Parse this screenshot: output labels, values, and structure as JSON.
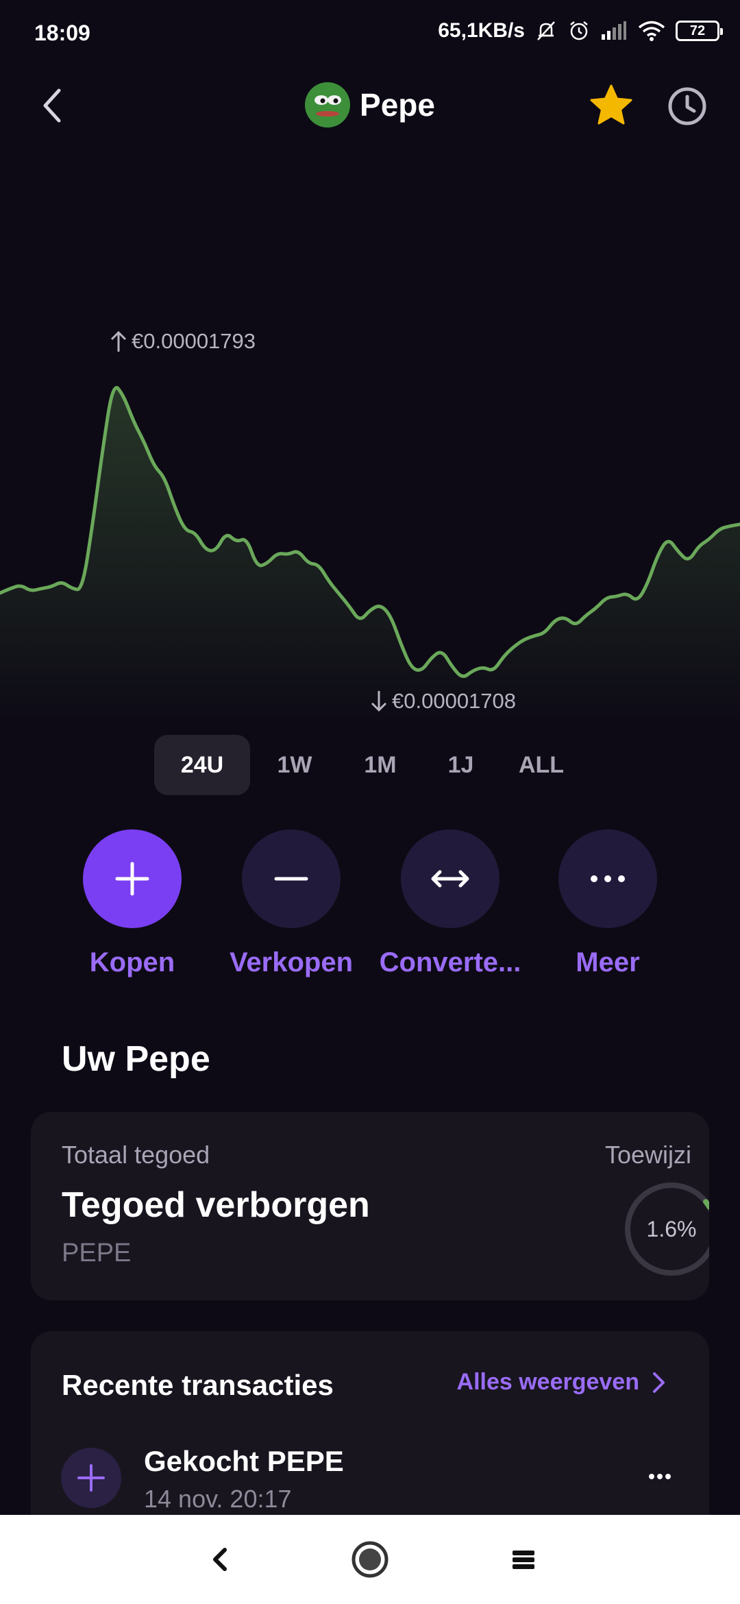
{
  "status_bar": {
    "time": "18:09",
    "network_speed": "65,1KB/s",
    "battery": "72",
    "icons": [
      "mute-bell-icon",
      "alarm-icon",
      "signal-icon",
      "wifi-icon",
      "battery-icon"
    ]
  },
  "header": {
    "title": "Pepe",
    "icons": [
      "back-arrow-icon",
      "pepe-logo",
      "star-icon",
      "history-clock-icon"
    ],
    "favorite_color": "#f5b800"
  },
  "chart": {
    "high_label": "€0.00001793",
    "low_label": "€0.00001708",
    "line_color": "#6aa85a"
  },
  "chart_data": {
    "type": "line",
    "title": "",
    "xlabel": "",
    "ylabel": "",
    "x": [
      0,
      1,
      2,
      3,
      4,
      5,
      6,
      7,
      8,
      9,
      10,
      11,
      12,
      13,
      14,
      15,
      16,
      17,
      18,
      19,
      20,
      21,
      22,
      23,
      24,
      25,
      26,
      27,
      28,
      29,
      30,
      31,
      32,
      33,
      34,
      35,
      36,
      37,
      38,
      39,
      40,
      41,
      42,
      43,
      44,
      45,
      46,
      47,
      48,
      49,
      50,
      51,
      52,
      53,
      54,
      55,
      56,
      57,
      58,
      59,
      60,
      61,
      62,
      63,
      64,
      65,
      66,
      67,
      68,
      69,
      70,
      71,
      72
    ],
    "values": [
      1.7557,
      1.7562,
      1.7566,
      1.7559,
      1.7562,
      1.7564,
      1.757,
      1.7562,
      1.756,
      1.7633,
      1.7719,
      1.7793,
      1.7779,
      1.7749,
      1.7727,
      1.7699,
      1.7687,
      1.7653,
      1.7627,
      1.7625,
      1.7605,
      1.7604,
      1.7625,
      1.7614,
      1.7619,
      1.7586,
      1.759,
      1.7602,
      1.76,
      1.7605,
      1.759,
      1.7589,
      1.757,
      1.7556,
      1.7542,
      1.7525,
      1.7538,
      1.7544,
      1.7532,
      1.75,
      1.7473,
      1.7469,
      1.7485,
      1.7493,
      1.7474,
      1.7461,
      1.747,
      1.7474,
      1.7469,
      1.7486,
      1.7497,
      1.7505,
      1.7509,
      1.7512,
      1.7527,
      1.753,
      1.752,
      1.7532,
      1.754,
      1.7552,
      1.7553,
      1.7557,
      1.7547,
      1.7567,
      1.76,
      1.7619,
      1.7603,
      1.7592,
      1.761,
      1.7617,
      1.7629,
      1.7632,
      1.7634
    ],
    "value_unit": "€ × 10^-5",
    "range": "24U",
    "grid": false,
    "legend": "none"
  },
  "range_tabs": [
    {
      "label": "24U",
      "active": true
    },
    {
      "label": "1W",
      "active": false
    },
    {
      "label": "1M",
      "active": false
    },
    {
      "label": "1J",
      "active": false
    },
    {
      "label": "ALL",
      "active": false
    }
  ],
  "actions": [
    {
      "label": "Kopen",
      "icon": "plus-icon",
      "primary": true
    },
    {
      "label": "Verkopen",
      "icon": "minus-icon",
      "primary": false
    },
    {
      "label": "Converte...",
      "icon": "convert-arrows-icon",
      "primary": false
    },
    {
      "label": "Meer",
      "icon": "more-dots-icon",
      "primary": false
    }
  ],
  "section_title": "Uw Pepe",
  "holding": {
    "label": "Totaal tegoed",
    "value": "Tegoed verborgen",
    "unit": "PEPE",
    "allocation_label": "Toewijzi",
    "allocation_text": "1.6%",
    "allocation_fraction": 0.016,
    "accent": "#6aa85a"
  },
  "transactions": {
    "title": "Recente transacties",
    "view_all": "Alles weergeven",
    "items": [
      {
        "name": "Gekocht PEPE",
        "date": "14 nov. 20:17",
        "icon": "plus-icon"
      }
    ]
  },
  "nav_bar": {
    "icons": [
      "nav-back-icon",
      "nav-home-icon",
      "nav-menu-icon"
    ]
  },
  "colors": {
    "background": "#0d0a15",
    "card": "#18151f",
    "accent_purple": "#7a3ff2",
    "link_purple": "#9a6cf6"
  }
}
